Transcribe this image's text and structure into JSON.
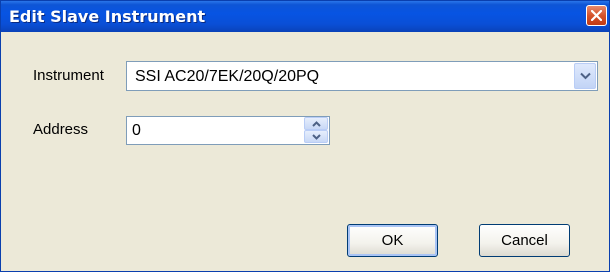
{
  "window": {
    "title": "Edit Slave Instrument"
  },
  "form": {
    "instrument_label": "Instrument",
    "instrument_value": "SSI AC20/7EK/20Q/20PQ",
    "address_label": "Address",
    "address_value": "0"
  },
  "buttons": {
    "ok": "OK",
    "cancel": "Cancel"
  }
}
